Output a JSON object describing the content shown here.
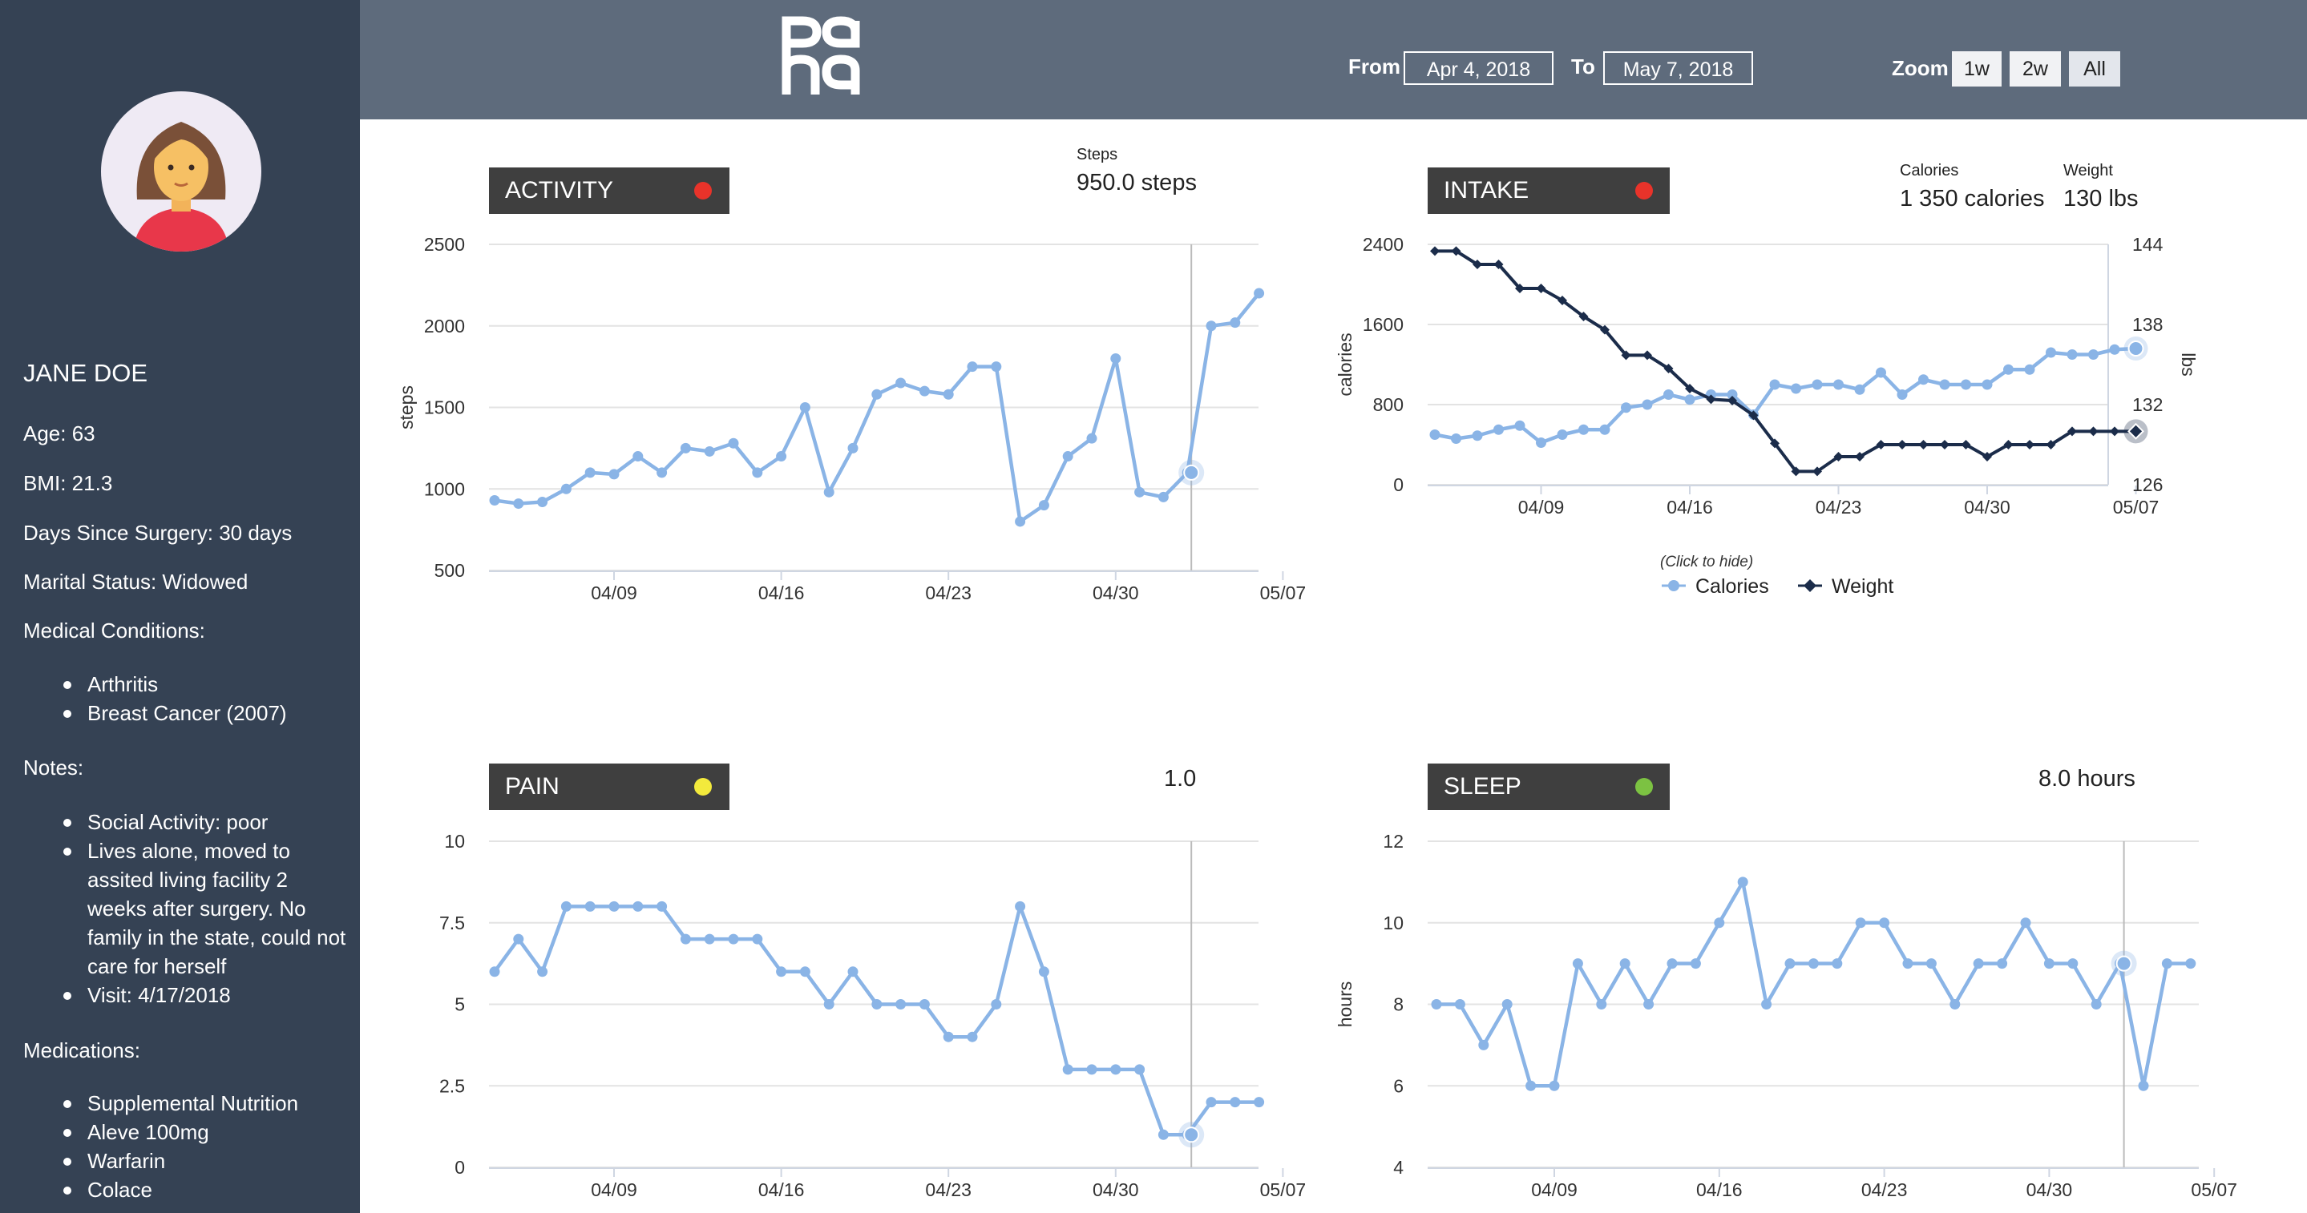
{
  "sidebar": {
    "patient_name": "JANE DOE",
    "age": "Age: 63",
    "bmi": "BMI: 21.3",
    "days_since_surgery": "Days Since Surgery: 30 days",
    "marital_status": "Marital Status: Widowed",
    "conditions_heading": "Medical Conditions:",
    "conditions": [
      "Arthritis",
      "Breast Cancer (2007)"
    ],
    "notes_heading": "Notes:",
    "notes": [
      "Social Activity: poor",
      "Lives alone, moved to assited living facility 2 weeks after surgery. No family in the state, could not care for herself",
      "Visit: 4/17/2018"
    ],
    "medications_heading": "Medications:",
    "medications": [
      "Supplemental Nutrition",
      "Aleve 100mg",
      "Warfarin",
      "Colace"
    ]
  },
  "header": {
    "logo_text": "pgha",
    "from_label": "From",
    "from_date": "Apr 4, 2018",
    "to_label": "To",
    "to_date": "May 7, 2018",
    "zoom_label": "Zoom",
    "zoom_options": [
      "1w",
      "2w",
      "All"
    ],
    "zoom_selected": "All"
  },
  "panels": {
    "activity": {
      "title": "ACTIVITY",
      "status_color": "#e8332a",
      "readout_label": "Steps",
      "readout_value": "950.0 steps"
    },
    "intake": {
      "title": "INTAKE",
      "status_color": "#e8332a",
      "readout_labels": [
        "Calories",
        "Weight"
      ],
      "readout_values": [
        "1 350 calories",
        "130 lbs"
      ],
      "legend_hint": "(Click to hide)"
    },
    "pain": {
      "title": "PAIN",
      "status_color": "#f3ea3c",
      "readout_value": "1.0"
    },
    "sleep": {
      "title": "SLEEP",
      "status_color": "#7cc242",
      "readout_value": "8.0 hours"
    }
  },
  "chart_data": [
    {
      "id": "activity",
      "type": "line",
      "x": [
        "2018-04-04",
        "2018-04-05",
        "2018-04-06",
        "2018-04-07",
        "2018-04-08",
        "2018-04-09",
        "2018-04-10",
        "2018-04-11",
        "2018-04-12",
        "2018-04-13",
        "2018-04-14",
        "2018-04-15",
        "2018-04-16",
        "2018-04-17",
        "2018-04-18",
        "2018-04-19",
        "2018-04-20",
        "2018-04-21",
        "2018-04-22",
        "2018-04-23",
        "2018-04-24",
        "2018-04-25",
        "2018-04-26",
        "2018-04-27",
        "2018-04-28",
        "2018-04-29",
        "2018-04-30",
        "2018-05-01",
        "2018-05-02",
        "2018-05-03",
        "2018-05-04",
        "2018-05-05",
        "2018-05-06",
        "2018-05-07"
      ],
      "series": [
        {
          "values": [
            930,
            910,
            920,
            1000,
            1100,
            1090,
            1200,
            1100,
            1250,
            1230,
            1280,
            1100,
            1200,
            1500,
            980,
            1250,
            1580,
            1650,
            1600,
            1580,
            1750,
            1750,
            800,
            900,
            1200,
            1310,
            1800,
            980,
            950,
            1100,
            2000,
            2020,
            2200
          ]
        }
      ],
      "xlabel": "",
      "ylabel": "steps",
      "xticks": [
        "04/09",
        "04/16",
        "04/23",
        "04/30",
        "05/07"
      ],
      "yticks": [
        500,
        1000,
        1500,
        2000,
        2500
      ],
      "ylim": [
        500,
        2500
      ],
      "xlim": [
        "2018-04-04",
        "2018-05-07"
      ],
      "highlight_x": "2018-05-03",
      "color": "#8ab4e6",
      "grid": true
    },
    {
      "id": "intake",
      "type": "line",
      "x": [
        "2018-04-04",
        "2018-04-05",
        "2018-04-06",
        "2018-04-07",
        "2018-04-08",
        "2018-04-09",
        "2018-04-10",
        "2018-04-11",
        "2018-04-12",
        "2018-04-13",
        "2018-04-14",
        "2018-04-15",
        "2018-04-16",
        "2018-04-17",
        "2018-04-18",
        "2018-04-19",
        "2018-04-20",
        "2018-04-21",
        "2018-04-22",
        "2018-04-23",
        "2018-04-24",
        "2018-04-25",
        "2018-04-26",
        "2018-04-27",
        "2018-04-28",
        "2018-04-29",
        "2018-04-30",
        "2018-05-01",
        "2018-05-02",
        "2018-05-03",
        "2018-05-04",
        "2018-05-05",
        "2018-05-06",
        "2018-05-07"
      ],
      "series": [
        {
          "name": "Calories",
          "axis": "left",
          "color": "#8ab4e6",
          "marker": "circle",
          "values": [
            500,
            460,
            490,
            550,
            590,
            420,
            500,
            550,
            550,
            770,
            800,
            900,
            850,
            900,
            900,
            700,
            1000,
            960,
            1000,
            1000,
            950,
            1120,
            900,
            1050,
            1000,
            1000,
            1000,
            1150,
            1150,
            1320,
            1300,
            1300,
            1350,
            1360
          ]
        },
        {
          "name": "Weight",
          "axis": "right",
          "color": "#1b2c4a",
          "marker": "diamond",
          "values": [
            143.5,
            143.5,
            142.5,
            142.5,
            140.7,
            140.7,
            139.8,
            138.6,
            137.6,
            135.7,
            135.7,
            134.7,
            133.2,
            132.4,
            132.3,
            131.2,
            129.1,
            127.0,
            127.0,
            128.1,
            128.1,
            129.0,
            129.0,
            129.0,
            129.0,
            129.0,
            128.1,
            129.0,
            129.0,
            129.0,
            130.0,
            130.0,
            130.0,
            130.0
          ]
        }
      ],
      "ylabel": "calories",
      "ylabel_right": "lbs",
      "xticks": [
        "04/09",
        "04/16",
        "04/23",
        "04/30",
        "05/07"
      ],
      "yticks": [
        0,
        800,
        1600,
        2400
      ],
      "yticks_right": [
        126,
        132,
        138,
        144
      ],
      "ylim": [
        0,
        2400
      ],
      "ylim_right": [
        126,
        144
      ],
      "legend": "bottom-center",
      "grid": true
    },
    {
      "id": "pain",
      "type": "line",
      "x": [
        "2018-04-04",
        "2018-04-05",
        "2018-04-06",
        "2018-04-07",
        "2018-04-08",
        "2018-04-09",
        "2018-04-10",
        "2018-04-11",
        "2018-04-12",
        "2018-04-13",
        "2018-04-14",
        "2018-04-15",
        "2018-04-16",
        "2018-04-17",
        "2018-04-18",
        "2018-04-19",
        "2018-04-20",
        "2018-04-21",
        "2018-04-22",
        "2018-04-23",
        "2018-04-24",
        "2018-04-25",
        "2018-04-26",
        "2018-04-27",
        "2018-04-28",
        "2018-04-29",
        "2018-04-30",
        "2018-05-01",
        "2018-05-02",
        "2018-05-03",
        "2018-05-04",
        "2018-05-05",
        "2018-05-06",
        "2018-05-07"
      ],
      "series": [
        {
          "values": [
            6,
            7,
            6,
            8,
            8,
            8,
            8,
            8,
            7,
            7,
            7,
            7,
            6,
            6,
            5,
            6,
            5,
            5,
            5,
            4,
            4,
            5,
            8,
            6,
            3,
            3,
            3,
            3,
            1,
            1,
            2,
            2,
            2
          ]
        }
      ],
      "ylabel": "",
      "xticks": [
        "04/09",
        "04/16",
        "04/23",
        "04/30",
        "05/07"
      ],
      "yticks": [
        0,
        2.5,
        5,
        7.5,
        10
      ],
      "ylim": [
        0,
        10
      ],
      "highlight_x": "2018-05-03",
      "color": "#8ab4e6",
      "grid": true
    },
    {
      "id": "sleep",
      "type": "line",
      "x": [
        "2018-04-04",
        "2018-04-05",
        "2018-04-06",
        "2018-04-07",
        "2018-04-08",
        "2018-04-09",
        "2018-04-10",
        "2018-04-11",
        "2018-04-12",
        "2018-04-13",
        "2018-04-14",
        "2018-04-15",
        "2018-04-16",
        "2018-04-17",
        "2018-04-18",
        "2018-04-19",
        "2018-04-20",
        "2018-04-21",
        "2018-04-22",
        "2018-04-23",
        "2018-04-24",
        "2018-04-25",
        "2018-04-26",
        "2018-04-27",
        "2018-04-28",
        "2018-04-29",
        "2018-04-30",
        "2018-05-01",
        "2018-05-02",
        "2018-05-03",
        "2018-05-04",
        "2018-05-05",
        "2018-05-06",
        "2018-05-07"
      ],
      "series": [
        {
          "values": [
            8,
            8,
            7,
            8,
            6,
            6,
            9,
            8,
            9,
            8,
            9,
            9,
            10,
            11,
            8,
            9,
            9,
            9,
            10,
            10,
            9,
            9,
            8,
            9,
            9,
            10,
            9,
            9,
            8,
            9,
            6,
            9,
            9
          ]
        }
      ],
      "ylabel": "hours",
      "xticks": [
        "04/09",
        "04/16",
        "04/23",
        "04/30",
        "05/07"
      ],
      "yticks": [
        4,
        6,
        8,
        10,
        12
      ],
      "ylim": [
        4,
        12
      ],
      "highlight_x": "2018-05-03",
      "color": "#8ab4e6",
      "grid": true
    }
  ]
}
